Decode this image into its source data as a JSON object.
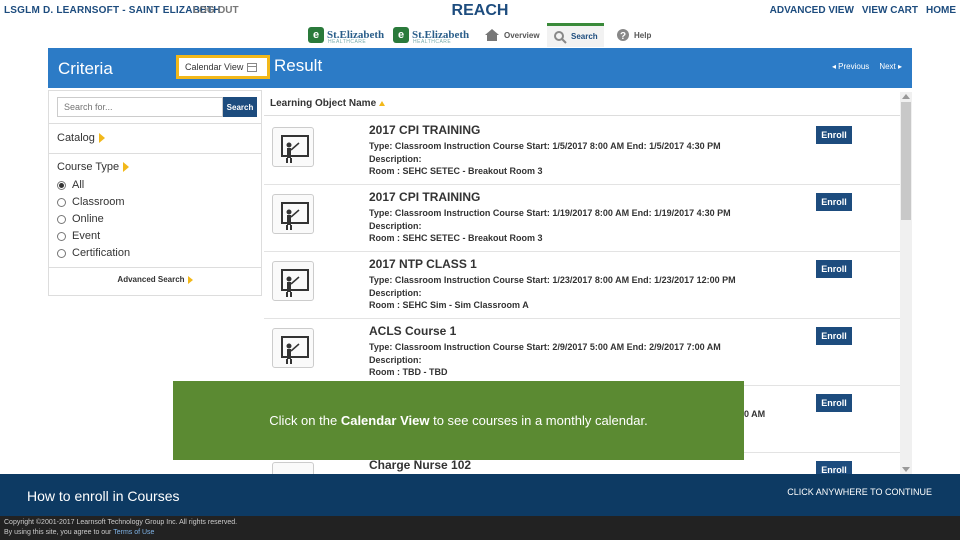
{
  "topbar": {
    "user": "LSGLM D. LEARNSOFT - SAINT ELIZABETH",
    "logout": "LOG OUT",
    "brand": "REACH",
    "links": [
      "ADVANCED VIEW",
      "VIEW CART",
      "HOME"
    ]
  },
  "logos": [
    {
      "name": "St.Elizabeth",
      "sub": "HEALTHCARE"
    },
    {
      "name": "St.Elizabeth",
      "sub": "HEALTHCARE"
    }
  ],
  "nav": {
    "overview": "Overview",
    "search": "Search",
    "help": "Help"
  },
  "header": {
    "criteria": "Criteria",
    "calendar_view": "Calendar View",
    "result": "Result",
    "previous": "◂ Previous",
    "next": "Next ▸"
  },
  "left_panel": {
    "search_placeholder": "Search for...",
    "search_button": "Search",
    "catalog": "Catalog",
    "course_type": "Course Type",
    "course_types": [
      "All",
      "Classroom",
      "Online",
      "Event",
      "Certification"
    ],
    "selected_type": "All",
    "advanced_search": "Advanced Search"
  },
  "results": {
    "column_header": "Learning Object Name",
    "enroll_label": "Enroll",
    "courses": [
      {
        "title": "2017 CPI TRAINING",
        "type": "Type: Classroom Instruction Course Start: 1/5/2017 8:00 AM End: 1/5/2017 4:30 PM",
        "description": "Description:",
        "room": "Room : SEHC SETEC - Breakout Room 3"
      },
      {
        "title": "2017 CPI TRAINING",
        "type": "Type: Classroom Instruction Course Start: 1/19/2017 8:00 AM End: 1/19/2017 4:30 PM",
        "description": "Description:",
        "room": "Room : SEHC SETEC - Breakout Room 3"
      },
      {
        "title": "2017 NTP CLASS 1",
        "type": "Type: Classroom Instruction Course Start: 1/23/2017 8:00 AM End: 1/23/2017 12:00 PM",
        "description": "Description:",
        "room": "Room : SEHC Sim - Sim Classroom A"
      },
      {
        "title": "ACLS Course 1",
        "type": "Type: Classroom Instruction Course Start: 2/9/2017 5:00 AM End: 2/9/2017 7:00 AM",
        "description": "Description:",
        "room": "Room : TBD - TBD"
      },
      {
        "title": "",
        "type": "0 AM",
        "description": "",
        "room": ""
      },
      {
        "title": "Charge Nurse 102",
        "type": "",
        "description": "",
        "room": ""
      }
    ]
  },
  "callout": {
    "before": "Click on the ",
    "bold": "Calendar View",
    "after": " to see courses in a monthly calendar."
  },
  "tutorial": {
    "title": "How to enroll in Courses",
    "continue": "CLICK ANYWHERE TO CONTINUE"
  },
  "footer": {
    "copyright": "Copyright ©2001-2017 Learnsoft Technology Group Inc. All rights reserved.",
    "agree": "By using this site, you agree to our ",
    "terms": "Terms of Use"
  }
}
